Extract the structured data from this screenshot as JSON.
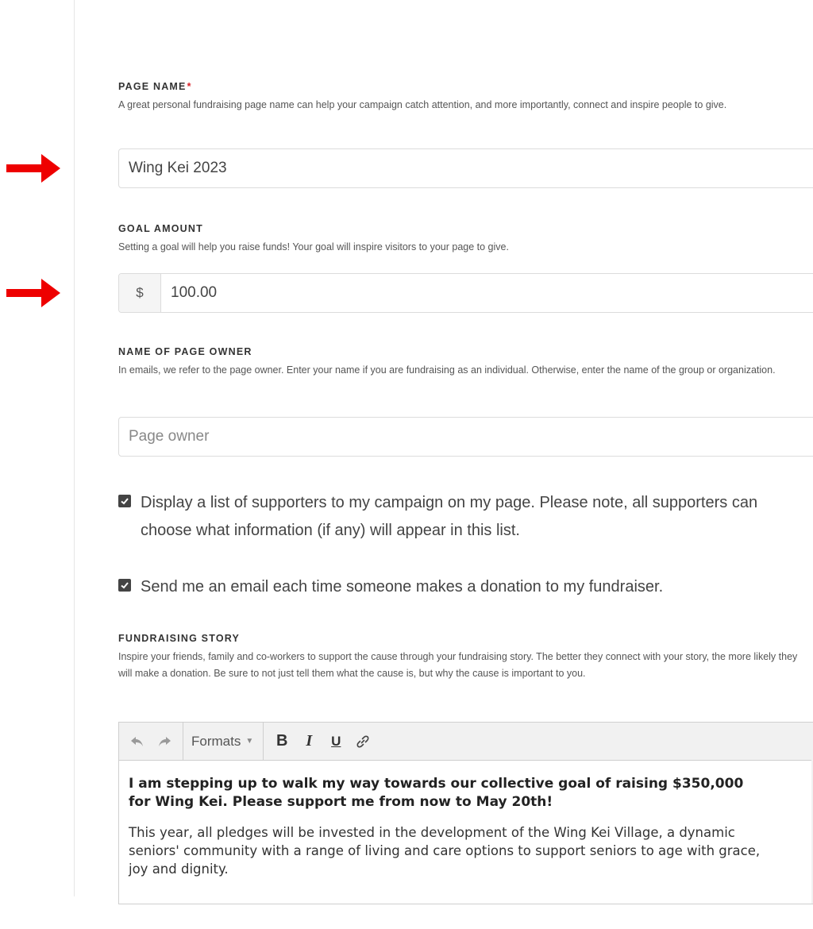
{
  "page_name": {
    "label": "PAGE NAME",
    "required_mark": "*",
    "help": "A great personal fundraising page name can help your campaign catch attention, and more importantly, connect and inspire people to give.",
    "value": "Wing Kei 2023"
  },
  "goal_amount": {
    "label": "GOAL AMOUNT",
    "help": "Setting a goal will help you raise funds! Your goal will inspire visitors to your page to give.",
    "currency": "$",
    "value": "100.00"
  },
  "page_owner": {
    "label": "NAME OF PAGE OWNER",
    "help": "In emails, we refer to the page owner. Enter your name if you are fundraising as an individual. Otherwise, enter the name of the group or organization.",
    "placeholder": "Page owner"
  },
  "options": {
    "display_supporters": "Display a list of supporters to my campaign on my page. Please note, all supporters can choose what information (if any) will appear in this list.",
    "email_on_donation": "Send me an email each time someone makes a donation to my fundraiser."
  },
  "fundraising_story": {
    "label": "FUNDRAISING STORY",
    "help": "Inspire your friends, family and co-workers to support the cause through your fundraising story. The better they connect with your story, the more likely they will make a donation. Be sure to not just tell them what the cause is, but why the cause is important to you.",
    "toolbar": {
      "formats_label": "Formats",
      "bold_label": "B",
      "italic_label": "I",
      "underline_label": "U"
    },
    "heading": "I am stepping up to walk my way towards our collective goal of raising $350,000 for Wing Kei. Please support me from now to May 20th!",
    "paragraph": "This year, all pledges will be invested in the development of the Wing Kei Village, a dynamic seniors' community with a range of living and care options to support seniors to age with grace, joy and dignity."
  },
  "colors": {
    "arrow": "#ee0000",
    "required": "#d9242a"
  }
}
